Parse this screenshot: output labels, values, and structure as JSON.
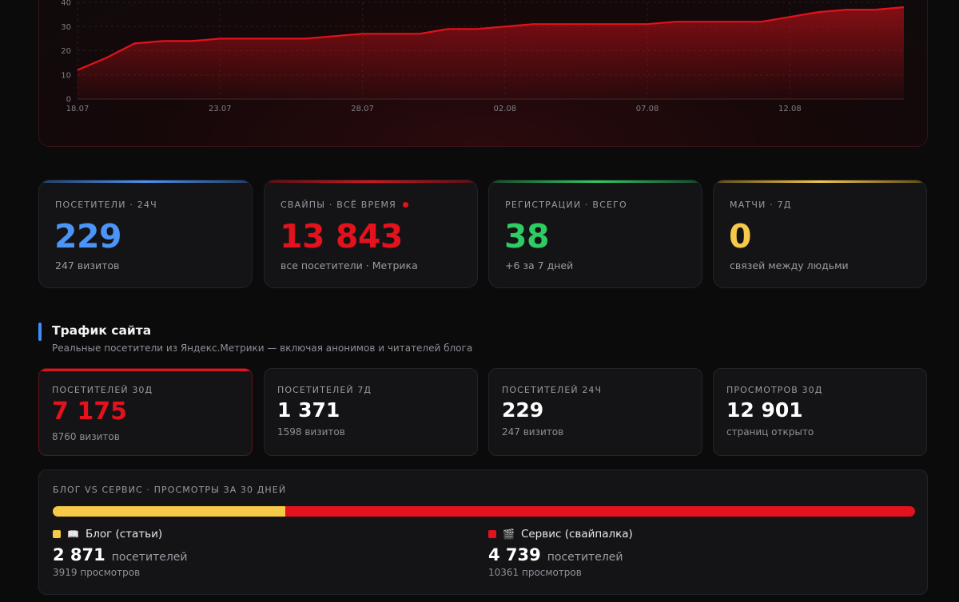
{
  "chart_data": {
    "type": "area",
    "x_ticks": [
      "18.07",
      "23.07",
      "28.07",
      "02.08",
      "07.08",
      "12.08"
    ],
    "y_ticks": [
      "0",
      "10",
      "20",
      "30",
      "40"
    ],
    "ylim": [
      0,
      40
    ],
    "grid": true,
    "color": "#e3121c",
    "series": [
      {
        "x": [
          "18.07",
          "19.07",
          "20.07",
          "21.07",
          "22.07",
          "23.07",
          "24.07",
          "25.07",
          "26.07",
          "27.07",
          "28.07",
          "29.07",
          "30.07",
          "31.07",
          "01.08",
          "02.08",
          "03.08",
          "04.08",
          "05.08",
          "06.08",
          "07.08",
          "08.08",
          "09.08",
          "10.08",
          "11.08",
          "12.08",
          "13.08",
          "14.08",
          "15.08",
          "16.08"
        ],
        "values": [
          12,
          17,
          23,
          24,
          24,
          25,
          25,
          25,
          25,
          26,
          27,
          27,
          27,
          29,
          29,
          30,
          31,
          31,
          31,
          31,
          31,
          32,
          32,
          32,
          32,
          34,
          36,
          37,
          37,
          38
        ]
      }
    ]
  },
  "stats": [
    {
      "label": "ПОСЕТИТЕЛИ · 24Ч",
      "value": "229",
      "sub": "247 визитов",
      "color": "#4a95f7"
    },
    {
      "label": "СВАЙПЫ · ВСЁ ВРЕМЯ",
      "value": "13 843",
      "sub": "все посетители · Метрика",
      "color": "#e3121c"
    },
    {
      "label": "РЕГИСТРАЦИИ · ВСЕГО",
      "value": "38",
      "sub": "+6 за 7 дней",
      "color": "#2ecc63"
    },
    {
      "label": "МАТЧИ · 7Д",
      "value": "0",
      "sub": "связей между людьми",
      "color": "#f7c948"
    }
  ],
  "traffic": {
    "title": "Трафик сайта",
    "subtitle": "Реальные посетители из Яндекс.Метрики — включая анонимов и читателей блога",
    "cards": [
      {
        "label": "ПОСЕТИТЕЛЕЙ 30Д",
        "value": "7 175",
        "sub": "8760 визитов"
      },
      {
        "label": "ПОСЕТИТЕЛЕЙ 7Д",
        "value": "1 371",
        "sub": "1598 визитов"
      },
      {
        "label": "ПОСЕТИТЕЛЕЙ 24Ч",
        "value": "229",
        "sub": "247 визитов"
      },
      {
        "label": "ПРОСМОТРОВ 30Д",
        "value": "12 901",
        "sub": "страниц открыто"
      }
    ]
  },
  "split": {
    "label": "БЛОГ VS СЕРВИС · ПРОСМОТРЫ ЗА 30 ДНЕЙ",
    "blog_share": 0.27,
    "blog": {
      "icon": "📖",
      "name": "Блог (статьи)",
      "value": "2 871",
      "unit": "посетителей",
      "views": "3919 просмотров",
      "color": "#f7c948"
    },
    "service": {
      "icon": "🎬",
      "name": "Сервис (свайпалка)",
      "value": "4 739",
      "unit": "посетителей",
      "views": "10361 просмотров",
      "color": "#e3121c"
    }
  }
}
